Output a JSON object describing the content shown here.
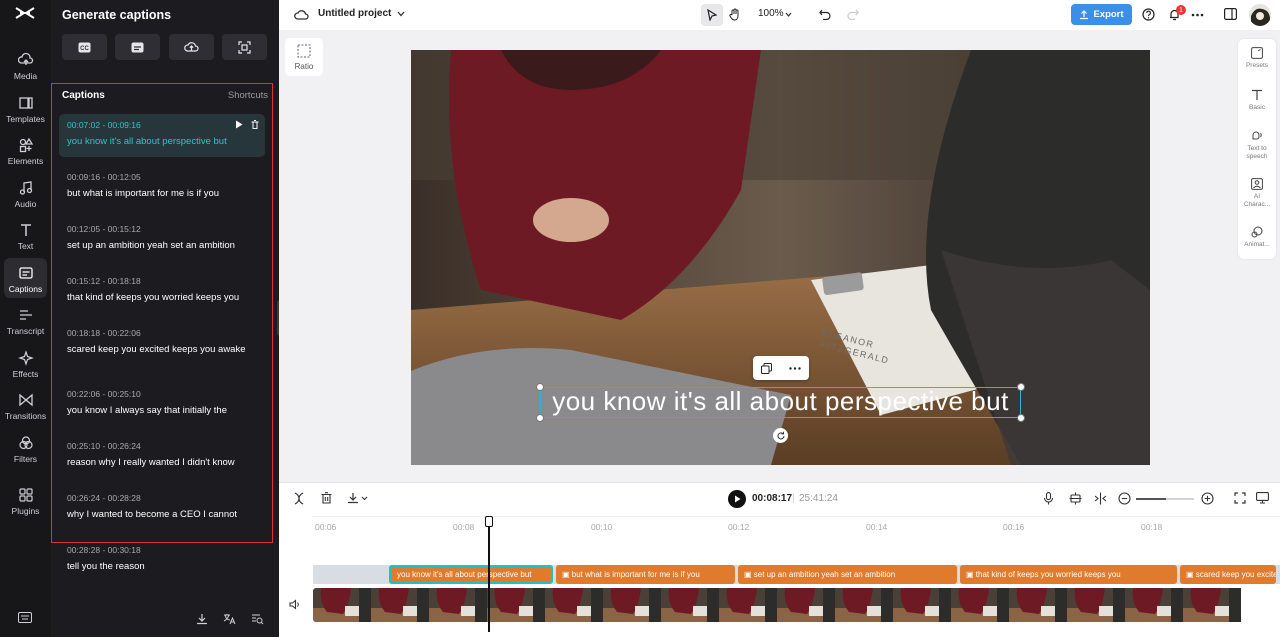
{
  "rail": {
    "items": [
      {
        "label": "Media",
        "icon": "media-icon"
      },
      {
        "label": "Templates",
        "icon": "templates-icon"
      },
      {
        "label": "Elements",
        "icon": "elements-icon"
      },
      {
        "label": "Audio",
        "icon": "audio-icon"
      },
      {
        "label": "Text",
        "icon": "text-icon"
      },
      {
        "label": "Captions",
        "icon": "captions-icon",
        "active": true
      },
      {
        "label": "Transcript",
        "icon": "transcript-icon"
      },
      {
        "label": "Effects",
        "icon": "effects-icon"
      },
      {
        "label": "Transitions",
        "icon": "transitions-icon"
      },
      {
        "label": "Filters",
        "icon": "filters-icon"
      },
      {
        "label": "Plugins",
        "icon": "plugins-icon"
      }
    ]
  },
  "panel": {
    "title": "Generate captions",
    "captions_header": "Captions",
    "shortcuts": "Shortcuts",
    "captions": [
      {
        "time": "00:07:02 - 00:09:16",
        "text": "you know it's all about perspective but",
        "active": true
      },
      {
        "time": "00:09:16 - 00:12:05",
        "text": "but what is important for me is if you"
      },
      {
        "time": "00:12:05 - 00:15:12",
        "text": "set up an ambition yeah set an ambition"
      },
      {
        "time": "00:15:12 - 00:18:18",
        "text": "that kind of keeps you worried keeps you"
      },
      {
        "time": "00:18:18 - 00:22:06",
        "text": "scared keep you excited keeps you awake"
      },
      {
        "time": "00:22:06 - 00:25:10",
        "text": "you know I always say that initially the"
      },
      {
        "time": "00:25:10 - 00:26:24",
        "text": "reason why I really wanted I didn't know"
      },
      {
        "time": "00:26:24 - 00:28:28",
        "text": "why I wanted to become a CEO I cannot"
      },
      {
        "time": "00:28:28 - 00:30:18",
        "text": "tell you the reason"
      }
    ]
  },
  "topbar": {
    "project_name": "Untitled project",
    "zoom": "100%",
    "export_label": "Export",
    "notification_count": "1"
  },
  "canvas": {
    "ratio_label": "Ratio",
    "caption_text": "you know it's all about perspective but",
    "document_text_1": "ELEANOR",
    "document_text_2": "FITZGERALD"
  },
  "props": {
    "items": [
      "Presets",
      "Basic",
      "Text to speech",
      "AI Charac...",
      "Animat..."
    ]
  },
  "timeline": {
    "current_time": "00:08:17",
    "total_time": "25:41:24",
    "ticks": [
      "00:06",
      "00:08",
      "00:10",
      "00:12",
      "00:14",
      "00:16",
      "00:18"
    ],
    "clips": [
      "you know it's all about perspective but",
      "but what is important for me is if you",
      "set up an ambition yeah set an ambition",
      "that kind of keeps you worried keeps you",
      "scared keep you excited keeps you awake"
    ]
  },
  "colors": {
    "accent": "#3a8fe8",
    "caption_clip": "#e07a2c",
    "active_caption": "#34c3c8",
    "highlight_border": "#e0303a"
  }
}
